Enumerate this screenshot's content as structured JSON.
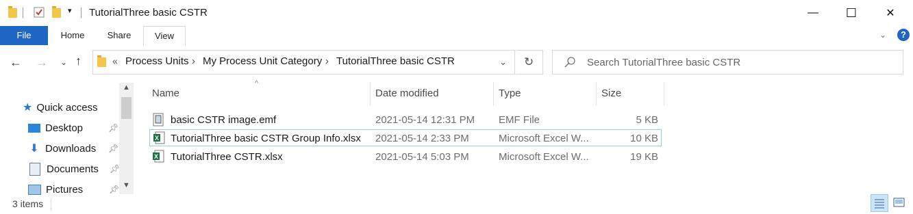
{
  "window": {
    "title": "TutorialThree basic CSTR",
    "minimize": "—",
    "maximize": "☐",
    "close": "✕"
  },
  "ribbon": {
    "tabs": [
      {
        "label": "File"
      },
      {
        "label": "Home"
      },
      {
        "label": "Share"
      },
      {
        "label": "View"
      }
    ],
    "help": "?"
  },
  "address": {
    "overflow": "«",
    "crumbs": [
      "Process Units",
      "My Process Unit Category",
      "TutorialThree basic CSTR"
    ]
  },
  "search": {
    "placeholder": "Search TutorialThree basic CSTR"
  },
  "nav": {
    "quick_access": "Quick access",
    "items": [
      {
        "label": "Desktop",
        "icon": "desktop-icon"
      },
      {
        "label": "Downloads",
        "icon": "download-icon"
      },
      {
        "label": "Documents",
        "icon": "document-icon"
      },
      {
        "label": "Pictures",
        "icon": "pictures-icon"
      }
    ]
  },
  "columns": {
    "name": "Name",
    "date": "Date modified",
    "type": "Type",
    "size": "Size"
  },
  "files": [
    {
      "name": "basic CSTR image.emf",
      "date": "2021-05-14 12:31 PM",
      "type": "EMF File",
      "size": "5 KB",
      "icon": "emf-file-icon"
    },
    {
      "name": "TutorialThree basic CSTR Group Info.xlsx",
      "date": "2021-05-14 2:33 PM",
      "type": "Microsoft Excel W...",
      "size": "10 KB",
      "icon": "excel-file-icon"
    },
    {
      "name": "TutorialThree CSTR.xlsx",
      "date": "2021-05-14 5:03 PM",
      "type": "Microsoft Excel W...",
      "size": "19 KB",
      "icon": "excel-file-icon"
    }
  ],
  "status": {
    "items_count": "3 items"
  },
  "colors": {
    "file_tab": "#1d66c1",
    "selection_border": "#99c9ef",
    "folder": "#f3c54a"
  }
}
